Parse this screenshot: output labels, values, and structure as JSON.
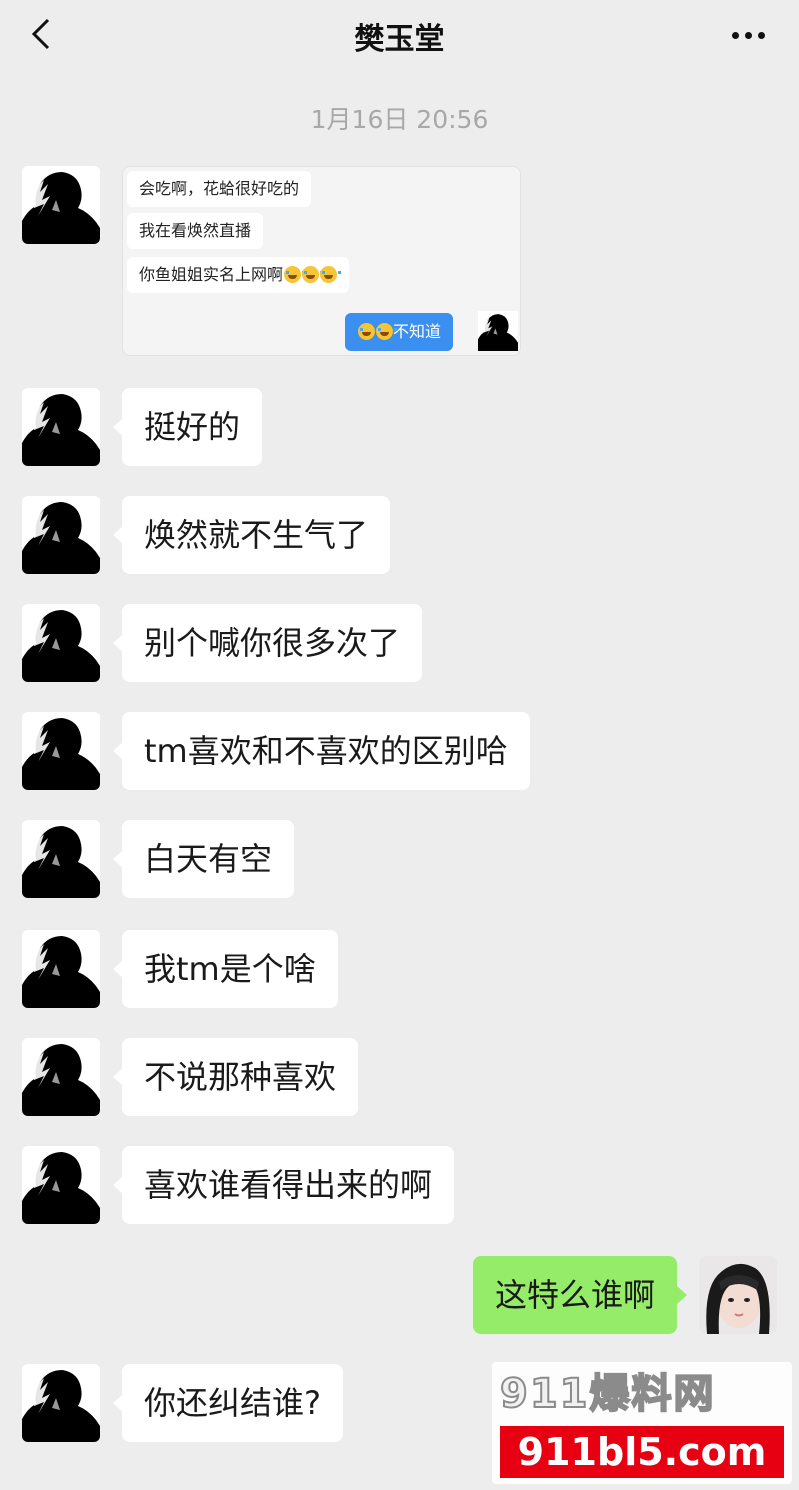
{
  "header": {
    "title": "樊玉堂"
  },
  "timestamp": "1月16日 20:56",
  "forwarded": {
    "lines": [
      "会吃啊，花蛤很好吃的",
      "我在看焕然直播",
      "你鱼姐姐实名上网啊"
    ],
    "reply": "不知道",
    "emoji": "grin-sweat-emoji"
  },
  "messages": [
    {
      "text": "挺好的"
    },
    {
      "text": "焕然就不生气了"
    },
    {
      "text": "别个喊你很多次了"
    },
    {
      "text": "tm喜欢和不喜欢的区别哈"
    },
    {
      "text": "白天有空"
    },
    {
      "text": "我tm是个啥"
    },
    {
      "text": "不说那种喜欢"
    },
    {
      "text": "喜欢谁看得出来的啊"
    },
    {
      "text": "这特么谁啊"
    },
    {
      "text": "你还纠结谁?"
    }
  ],
  "watermark": {
    "brand": "911爆料网",
    "url": "911bl5.com"
  },
  "colors": {
    "background": "#ededed",
    "bubble_mine": "#95ec69",
    "bubble_other": "#ffffff",
    "forward_reply": "#3a8ff0"
  }
}
